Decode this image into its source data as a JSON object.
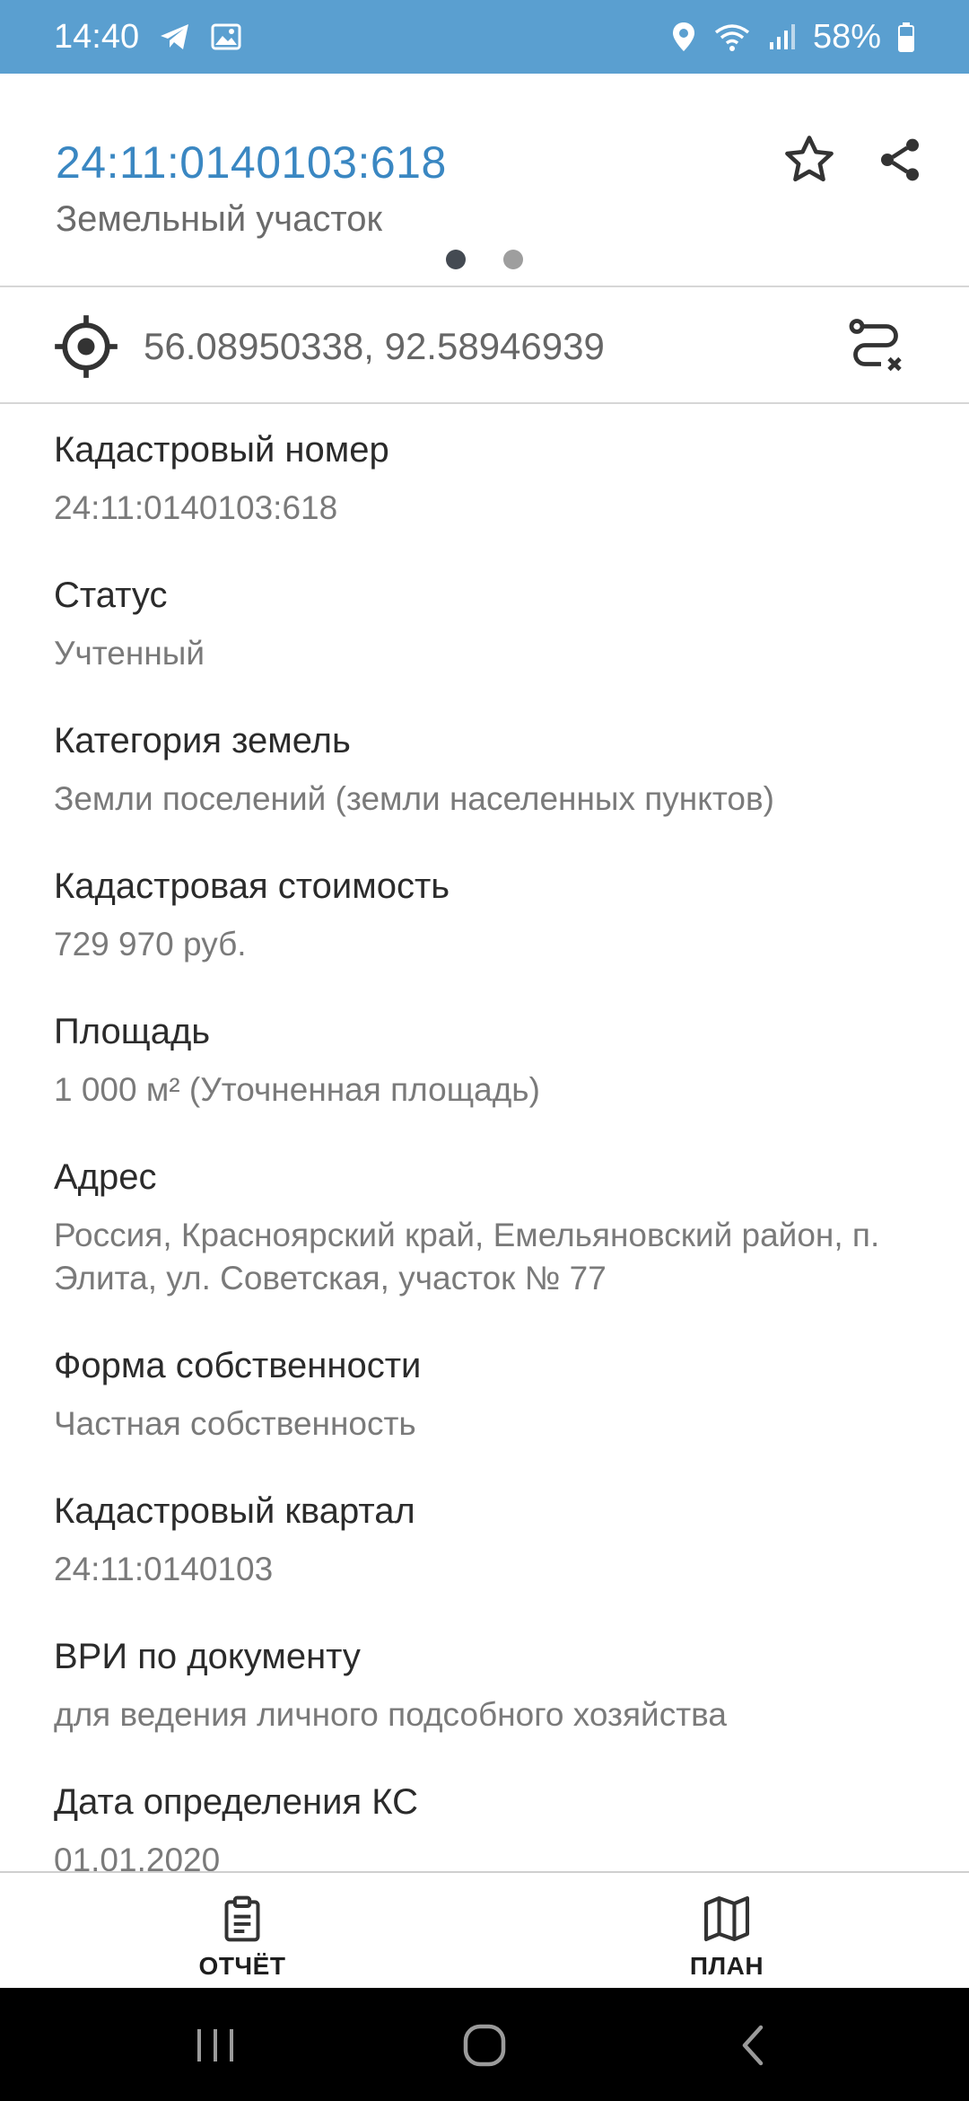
{
  "status_bar": {
    "time": "14:40",
    "battery": "58%",
    "icons": [
      "telegram-icon",
      "gallery-icon",
      "location-icon",
      "wifi-icon",
      "signal-icon",
      "battery-icon"
    ]
  },
  "header": {
    "title": "24:11:0140103:618",
    "subtitle": "Земельный участок",
    "page_indicator": {
      "current": 1,
      "total": 2
    }
  },
  "coordinates": {
    "text": "56.08950338, 92.58946939"
  },
  "fields": [
    {
      "label": "Кадастровый номер",
      "value": "24:11:0140103:618"
    },
    {
      "label": "Статус",
      "value": "Учтенный"
    },
    {
      "label": "Категория земель",
      "value": "Земли поселений (земли населенных пунктов)"
    },
    {
      "label": "Кадастровая стоимость",
      "value": "729 970 руб."
    },
    {
      "label": "Площадь",
      "value": "1 000 м² (Уточненная площадь)"
    },
    {
      "label": "Адрес",
      "value": "Россия, Красноярский край, Емельяновский район, п. Элита, ул. Советская, участок № 77"
    },
    {
      "label": "Форма собственности",
      "value": "Частная собственность"
    },
    {
      "label": "Кадастровый квартал",
      "value": "24:11:0140103"
    },
    {
      "label": "ВРИ по документу",
      "value": "для ведения личного подсобного хозяйства"
    },
    {
      "label": "Дата определения КС",
      "value": "01.01.2020"
    }
  ],
  "bottom_nav": {
    "report_label": "ОТЧЁТ",
    "plan_label": "ПЛАН"
  },
  "colors": {
    "status_bar": "#5a9fd0",
    "title": "#3a87c2",
    "label": "#2b2b2b",
    "value": "#7a7a7a"
  }
}
